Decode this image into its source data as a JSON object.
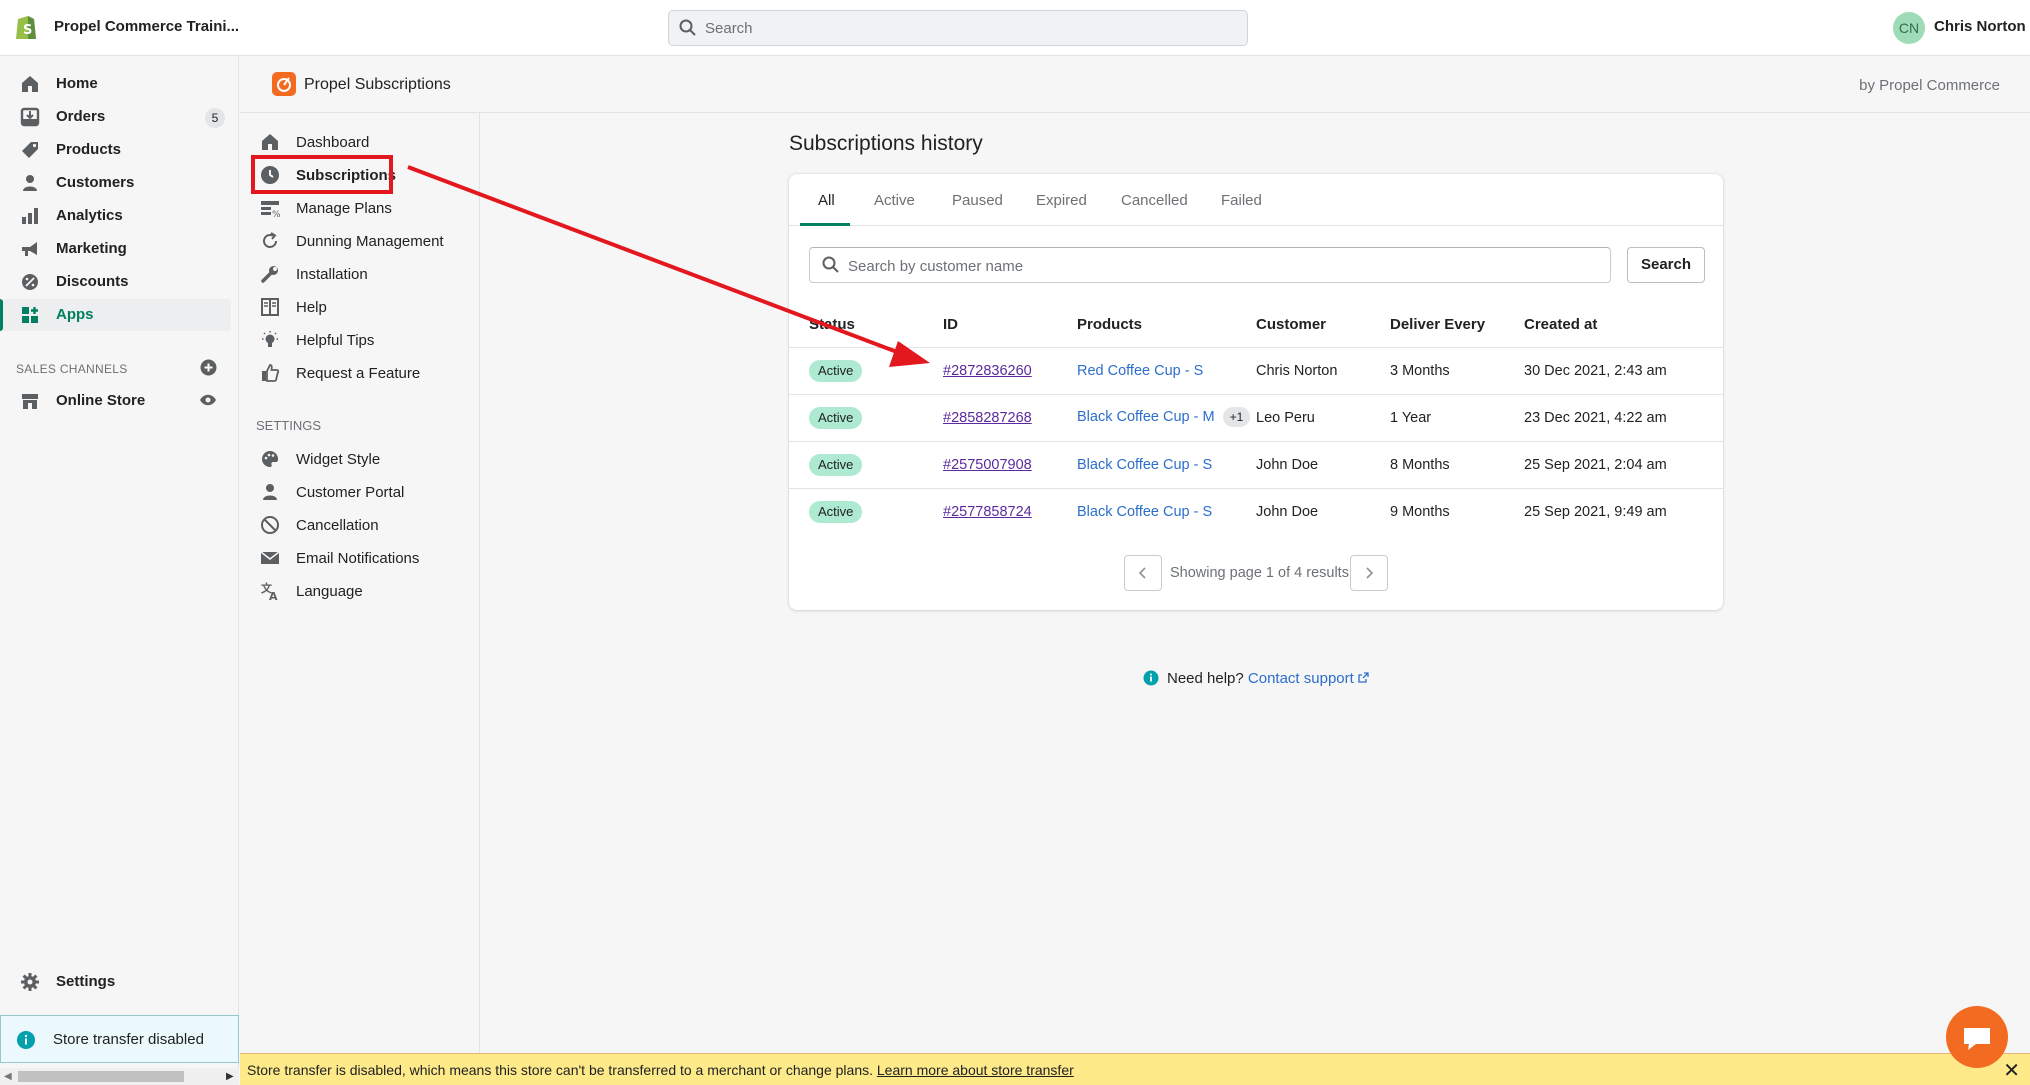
{
  "topbar": {
    "store_name": "Propel Commerce Traini...",
    "search_placeholder": "Search",
    "user_initials": "CN",
    "user_name": "Chris Norton"
  },
  "nav": {
    "items": [
      {
        "label": "Home",
        "icon": "home-icon"
      },
      {
        "label": "Orders",
        "icon": "orders-icon",
        "badge": "5"
      },
      {
        "label": "Products",
        "icon": "tag-icon"
      },
      {
        "label": "Customers",
        "icon": "person-icon"
      },
      {
        "label": "Analytics",
        "icon": "bar-chart-icon"
      },
      {
        "label": "Marketing",
        "icon": "megaphone-icon"
      },
      {
        "label": "Discounts",
        "icon": "discount-icon"
      },
      {
        "label": "Apps",
        "icon": "apps-icon",
        "active": true
      }
    ],
    "sales_channels_label": "SALES CHANNELS",
    "online_store": "Online Store",
    "settings": "Settings",
    "transfer_notice": "Store transfer disabled"
  },
  "app": {
    "title": "Propel Subscriptions",
    "by": "by Propel Commerce",
    "menu": [
      {
        "label": "Dashboard",
        "icon": "home-icon"
      },
      {
        "label": "Subscriptions",
        "icon": "clock-icon"
      },
      {
        "label": "Manage Plans",
        "icon": "plans-icon"
      },
      {
        "label": "Dunning Management",
        "icon": "refresh-icon"
      },
      {
        "label": "Installation",
        "icon": "wrench-icon"
      },
      {
        "label": "Help",
        "icon": "book-icon"
      },
      {
        "label": "Helpful Tips",
        "icon": "lightbulb-icon"
      },
      {
        "label": "Request a Feature",
        "icon": "thumbs-up-icon"
      }
    ],
    "settings_label": "SETTINGS",
    "settings_menu": [
      {
        "label": "Widget Style",
        "icon": "palette-icon"
      },
      {
        "label": "Customer Portal",
        "icon": "person-icon"
      },
      {
        "label": "Cancellation",
        "icon": "cancel-icon"
      },
      {
        "label": "Email Notifications",
        "icon": "envelope-icon"
      },
      {
        "label": "Language",
        "icon": "translate-icon"
      }
    ]
  },
  "main": {
    "title": "Subscriptions history",
    "tabs": [
      "All",
      "Active",
      "Paused",
      "Expired",
      "Cancelled",
      "Failed"
    ],
    "search_placeholder": "Search by customer name",
    "search_button": "Search",
    "columns": [
      "Status",
      "ID",
      "Products",
      "Customer",
      "Deliver Every",
      "Created at"
    ],
    "rows": [
      {
        "status": "Active",
        "id": "#2872836260",
        "product": "Red Coffee Cup - S",
        "extra": "",
        "customer": "Chris Norton",
        "deliver": "3 Months",
        "created": "30 Dec 2021, 2:43 am"
      },
      {
        "status": "Active",
        "id": "#2858287268",
        "product": "Black Coffee Cup - M",
        "extra": "+1",
        "customer": "Leo Peru",
        "deliver": "1 Year",
        "created": "23 Dec 2021, 4:22 am"
      },
      {
        "status": "Active",
        "id": "#2575007908",
        "product": "Black Coffee Cup - S",
        "extra": "",
        "customer": "John Doe",
        "deliver": "8 Months",
        "created": "25 Sep 2021, 2:04 am"
      },
      {
        "status": "Active",
        "id": "#2577858724",
        "product": "Black Coffee Cup - S",
        "extra": "",
        "customer": "John Doe",
        "deliver": "9 Months",
        "created": "25 Sep 2021, 9:49 am"
      }
    ],
    "pager_text": "Showing page 1 of 4 results",
    "help_text": "Need help?",
    "help_link": "Contact support"
  },
  "bottom_bar": {
    "text": "Store transfer is disabled, which means this store can't be transferred to a merchant or change plans.",
    "link": "Learn more about store transfer"
  },
  "colors": {
    "accent": "#008060",
    "annotation_red": "#e3181f",
    "brand_orange": "#f26b21"
  }
}
